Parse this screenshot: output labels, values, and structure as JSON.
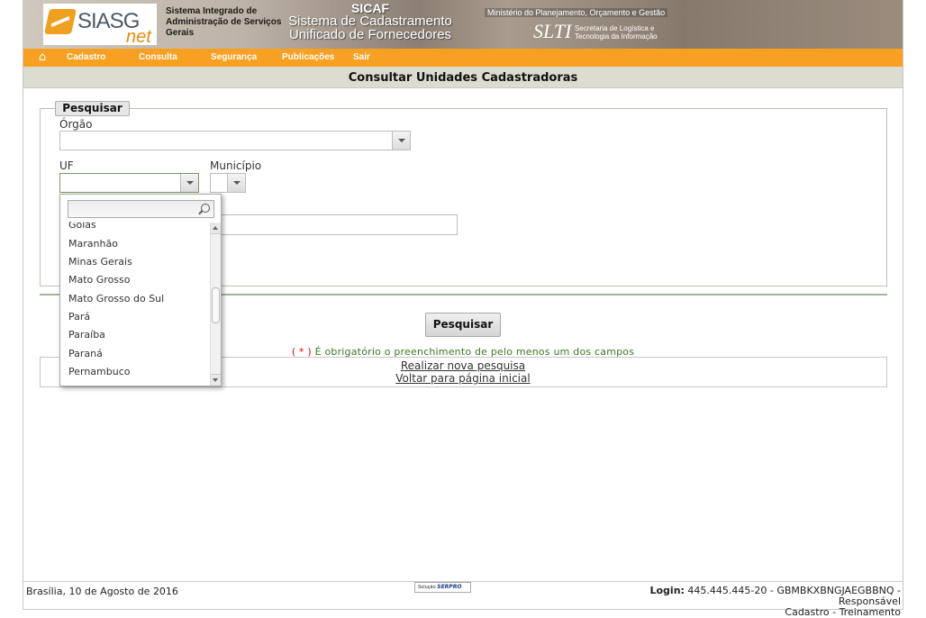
{
  "header": {
    "logo_main": "SIASG",
    "logo_sub": "net",
    "system_name": "Sistema Integrado de Administração de Serviços Gerais",
    "sicaf_title": "SICAF",
    "sicaf_subtitle_1": "Sistema de Cadastramento",
    "sicaf_subtitle_2": "Unificado de Fornecedores",
    "ministry": "Ministério do Planejamento, Orçamento e Gestão",
    "slti": "SLTI",
    "slti_text_1": "Secretaria de Logística e",
    "slti_text_2": "Tecnologia da Informação"
  },
  "nav": {
    "items": [
      {
        "label": "Cadastro"
      },
      {
        "label": "Consulta"
      },
      {
        "label": "Segurança"
      },
      {
        "label": "Publicações"
      },
      {
        "label": "Sair"
      }
    ]
  },
  "page": {
    "title": "Consultar Unidades Cadastradoras"
  },
  "form": {
    "legend": "Pesquisar",
    "orgao_label": "Órgão",
    "orgao_value": "",
    "uf_label": "UF",
    "uf_value": "",
    "municipio_label": "Município",
    "municipio_value": "",
    "search_button": "Pesquisar",
    "required_star": "( * )",
    "required_note": " É obrigatório o preenchimento de pelo menos um dos campos"
  },
  "dropdown": {
    "search_value": "",
    "items": [
      {
        "label": "Goiás"
      },
      {
        "label": "Maranhão"
      },
      {
        "label": "Minas Gerais"
      },
      {
        "label": "Mato Grosso"
      },
      {
        "label": "Mato Grosso do Sul"
      },
      {
        "label": "Pará"
      },
      {
        "label": "Paraíba"
      },
      {
        "label": "Paraná"
      },
      {
        "label": "Pernambuco"
      }
    ]
  },
  "links": {
    "new_search": "Realizar nova pesquisa",
    "home": "Voltar para página inicial"
  },
  "footer": {
    "date": "Brasília, 10 de Agosto de 2016",
    "logo_prefix": "Solução",
    "logo_brand": "SERPRO",
    "login_label": "Login:",
    "login_value": " 445.445.445-20 - GBMBKXBNGJAEGBBNQ - Responsável",
    "login_line2": "Cadastro - Treinamento"
  },
  "colors": {
    "nav_bg": "#f7a021",
    "title_bg": "#dcdcd0",
    "note_green": "#3a7a21"
  }
}
